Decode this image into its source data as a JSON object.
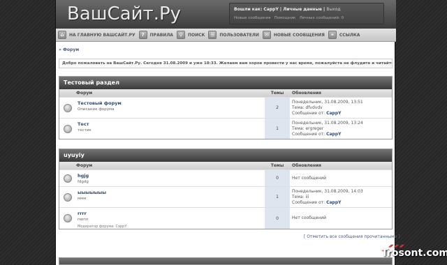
{
  "site_title": "ВашСайт.Ру",
  "userbar": {
    "logged_in_label": "Вошли как: CappY",
    "sep1": "|",
    "personal_data": "Личные данные",
    "sep2": "|",
    "logout": "Выход",
    "new_messages": "Новые сообщения",
    "help": "Помощник",
    "private_msgs": "Личных сообщений: 0"
  },
  "nav": [
    {
      "label": "на главную ВашСайт.Ру",
      "icon": "home-icon",
      "glyph": "⌂"
    },
    {
      "label": "Правила",
      "icon": "rules-icon",
      "glyph": "?"
    },
    {
      "label": "Поиск",
      "icon": "search-icon",
      "glyph": "⚲"
    },
    {
      "label": "Пользователи",
      "icon": "users-icon",
      "glyph": "☰"
    },
    {
      "label": "Новые сообщения",
      "icon": "new-posts-icon",
      "glyph": "✉"
    },
    {
      "label": "Ссылка",
      "icon": "link-icon",
      "glyph": "⚭"
    }
  ],
  "breadcrumb": "» Форум",
  "welcome": "Добро пожаловать на ВашСайт.Ру. Сегодня 31.08.2009 и уже 18:33. Желаем вам хорое провести у нас время, пожалуйста не флудите и читайте правила!",
  "headers": {
    "forum": "Форум",
    "topics": "Темы",
    "updates": "Обновления"
  },
  "categories": [
    {
      "title": "Тестовый раздел",
      "forums": [
        {
          "name": "Тестовый форум",
          "desc": "Описание форума",
          "moderator": "",
          "topics": "2",
          "lp_date": "Понедельник, 31.08.2009, 13:51",
          "lp_topic": "Тема: dfvdvdv",
          "lp_by": "Сообщение от: ",
          "lp_user": "CappY"
        },
        {
          "name": "Тест",
          "desc": "тестик",
          "moderator": "",
          "topics": "1",
          "lp_date": "Понедельник, 31.08.2009, 13:24",
          "lp_topic": "Тема: ergreger",
          "lp_by": "Сообщение от: ",
          "lp_user": "CappY"
        }
      ]
    },
    {
      "title": "uyuyiy",
      "forums": [
        {
          "name": "hgjg",
          "desc": "fdgdg",
          "moderator": "",
          "topics": "0",
          "lp_date": "",
          "lp_topic": "Нет сообщений",
          "lp_by": "",
          "lp_user": ""
        },
        {
          "name": "ыыыыыыы",
          "desc": "ммм",
          "moderator": "",
          "topics": "1",
          "lp_date": "Понедельник, 31.08.2009, 14:03",
          "lp_topic": "Тема: iii",
          "lp_by": "Сообщение от: ",
          "lp_user": "CappY"
        },
        {
          "name": "rrrr",
          "desc": "пюпп",
          "moderator": "Модератор форума:    CappY",
          "topics": "0",
          "lp_date": "",
          "lp_topic": "Нет сообщений",
          "lp_by": "",
          "lp_user": ""
        }
      ]
    }
  ],
  "mark_all": "[ Отметить все сообщения прочитанными ]",
  "watermark": "Trosont.com"
}
